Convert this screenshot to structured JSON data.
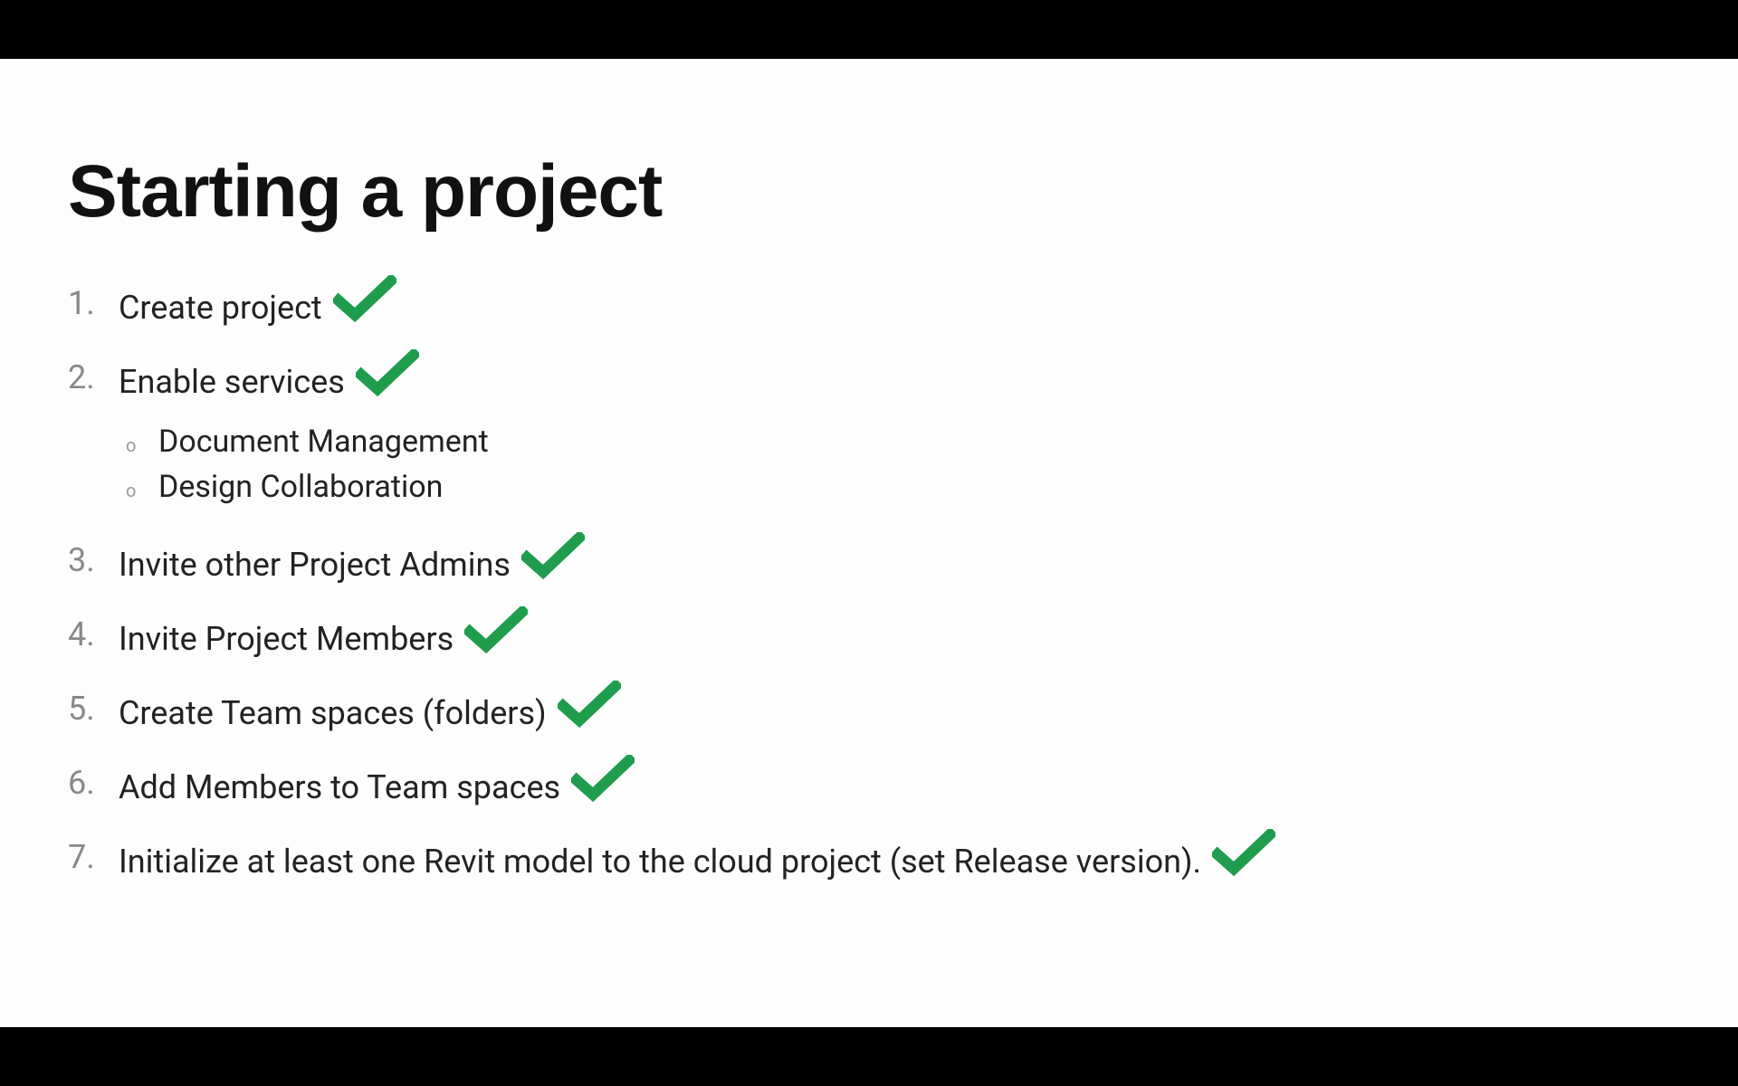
{
  "title": "Starting a project",
  "items": [
    {
      "num": "1.",
      "text": "Create project",
      "checked": true,
      "sub": []
    },
    {
      "num": "2.",
      "text": "Enable services",
      "checked": true,
      "sub": [
        {
          "text": "Document Management"
        },
        {
          "text": "Design Collaboration"
        }
      ]
    },
    {
      "num": "3.",
      "text": "Invite other Project Admins",
      "checked": true,
      "sub": []
    },
    {
      "num": "4.",
      "text": "Invite Project Members",
      "checked": true,
      "sub": []
    },
    {
      "num": "5.",
      "text": "Create Team spaces (folders)",
      "checked": true,
      "sub": []
    },
    {
      "num": "6.",
      "text": "Add Members to Team spaces",
      "checked": true,
      "sub": []
    },
    {
      "num": "7.",
      "text": "Initialize at least one Revit model to the cloud project (set Release version).",
      "checked": true,
      "sub": []
    }
  ],
  "colors": {
    "check": "#1f9d4d"
  }
}
